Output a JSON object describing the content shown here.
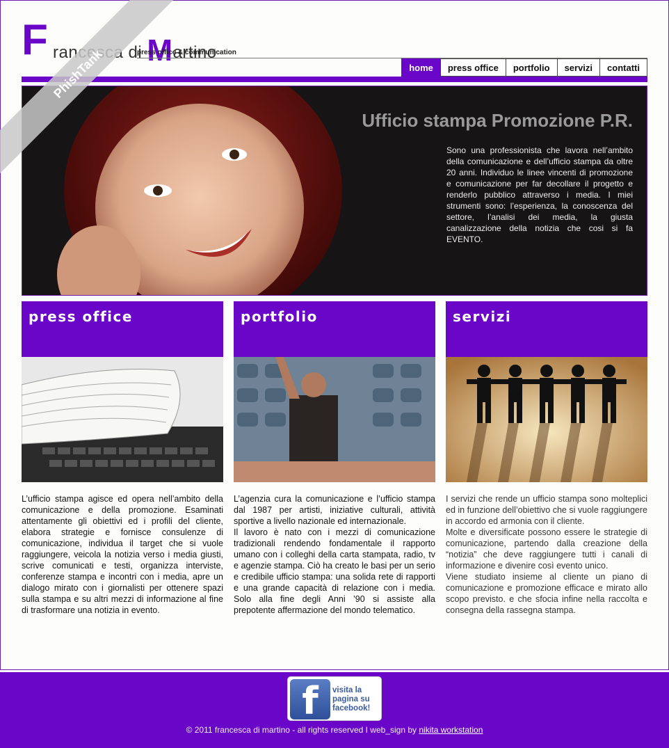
{
  "header": {
    "logo_initial": "F",
    "logo_text_1": "rancesca di ",
    "logo_big_m": "M",
    "logo_text_2": "artino",
    "logo_subtitle": "press office & communication"
  },
  "nav": {
    "items": [
      {
        "label": "home",
        "active": true
      },
      {
        "label": "press office"
      },
      {
        "label": "portfolio"
      },
      {
        "label": "servizi"
      },
      {
        "label": "contatti"
      }
    ]
  },
  "ribbon": {
    "label": "PhishTank"
  },
  "hero": {
    "title": "Ufficio stampa Promozione P.R.",
    "text": "Sono una professionista che lavora nell’ambito della comunicazione e dell’ufficio stampa da oltre 20 anni. Individuo le linee vincenti di promozione e comunicazione per far decollare il progetto e renderlo pubblico attraverso i media. I miei strumenti sono: l’esperienza, la conoscenza del settore, l’analisi dei media, la giusta canalizzazione della notizia che cosi si fa EVENTO."
  },
  "columns": [
    {
      "title": "press office",
      "paragraphs": [
        "L’ufficio stampa agisce ed opera nell’ambito della comunicazione e della promozione. Esaminati attentamente gli obiettivi ed i profili del cliente, elabora strategie e fornisce consulenze di comunicazione, individua il target che si vuole raggiungere, veicola la notizia verso i media giusti, scrive comunicati e testi, organizza interviste, conferenze stampa e incontri con i media, apre un dialogo mirato con i giornalisti per ottenere spazi sulla stampa e su altri mezzi di informazione al fine di trasformare una notizia in evento."
      ]
    },
    {
      "title": "portfolio",
      "paragraphs": [
        "L’agenzia cura la comunicazione e l’ufficio stampa dal 1987 per artisti, iniziative culturali, attività sportive a livello nazionale ed internazionale.",
        "Il lavoro è nato con i mezzi di comunicazione tradizionali rendendo fondamentale il rapporto umano con i colleghi della carta stampata, radio, tv e agenzie stampa. Ciò ha creato le basi per un serio e credibile ufficio stampa: una solida rete di rapporti e una grande capacità di relazione con i media. Solo alla fine degli Anni ’90 si assiste alla prepotente affermazione del mondo telematico."
      ]
    },
    {
      "title": "servizi",
      "paragraphs": [
        "I servizi che rende un ufficio stampa sono molteplici ed in funzione dell’obiettivo che si vuole raggiungere in accordo ed armonia con il cliente.",
        "Molte e diversificate possono essere le strategie di comunicazione, partendo dalla creazione della “notizia” che deve raggiungere tutti i canali di informazione e divenire così evento unico.",
        "Viene studiato insieme al cliente un piano di comunicazione e promozione efficace e mirato allo scopo previsto. e che sfocia infine nella raccolta e consegna della rassegna stampa."
      ]
    }
  ],
  "footer": {
    "fb_letter": "f",
    "fb_line1": "visita la",
    "fb_line2": "pagina su",
    "fb_line3": "facebook!",
    "copyright": "© 2011 francesca di martino - all rights reserved I web_sign by ",
    "credit_link": "nikita workstation"
  }
}
